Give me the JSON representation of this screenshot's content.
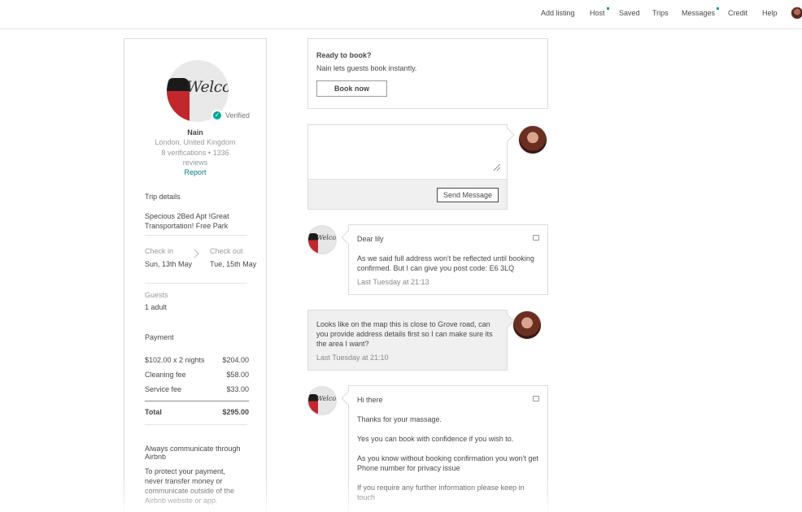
{
  "nav": {
    "add_listing": "Add listing",
    "host": "Host",
    "saved": "Saved",
    "trips": "Trips",
    "messages": "Messages",
    "credit": "Credit",
    "help": "Help"
  },
  "profile": {
    "avatar_text": "Welcom",
    "verified": "Verified",
    "name": "Nain",
    "location": "London, United Kingdom",
    "verifications": "8 verifications • 1336 reviews",
    "report": "Report",
    "trip_details_heading": "Trip details",
    "listing_name": "Specious 2Bed Apt !Great Transportation! Free Park",
    "check_in_label": "Check in",
    "check_in_value": "Sun, 13th May",
    "check_out_label": "Check out",
    "check_out_value": "Tue, 15th May",
    "guests_label": "Guests",
    "guests_value": "1 adult",
    "payment_heading": "Payment",
    "payment_rows": [
      {
        "label": "$102.00 x 2 nights",
        "amount": "$204.00"
      },
      {
        "label": "Cleaning fee",
        "amount": "$58.00"
      },
      {
        "label": "Service fee",
        "amount": "$33.00"
      }
    ],
    "total_label": "Total",
    "total_amount": "$295.00",
    "communicate_heading": "Always communicate through Airbnb",
    "communicate_text": "To protect your payment, never transfer money or communicate outside of the Airbnb website or app."
  },
  "ready": {
    "title": "Ready to book?",
    "subtitle": "Nain lets guests book instantly.",
    "button": "Book now"
  },
  "compose": {
    "value": "",
    "send_button": "Send Message"
  },
  "messages": [
    {
      "sender": "host",
      "lines": [
        "Dear lily",
        "As we said full address won't be reflected until booking confirmed. But I can give you post code: E6 3LQ"
      ],
      "time": "Last Tuesday at 21:13"
    },
    {
      "sender": "guest",
      "lines": [
        "Looks like on the map this is close to Grove road, can you provide address details first so I can make sure its the area I want?"
      ],
      "time": "Last Tuesday at 21:10"
    },
    {
      "sender": "host",
      "lines": [
        "Hi there",
        "Thanks for your massage.",
        "Yes you can book with confidence if you wish to.",
        "As you know without booking confirmation you won't get Phone number for privacy issue",
        "If you require any further information please keep in touch"
      ]
    }
  ],
  "colors": {
    "accent": "#00a699",
    "link": "#007a87",
    "text": "#484848"
  }
}
